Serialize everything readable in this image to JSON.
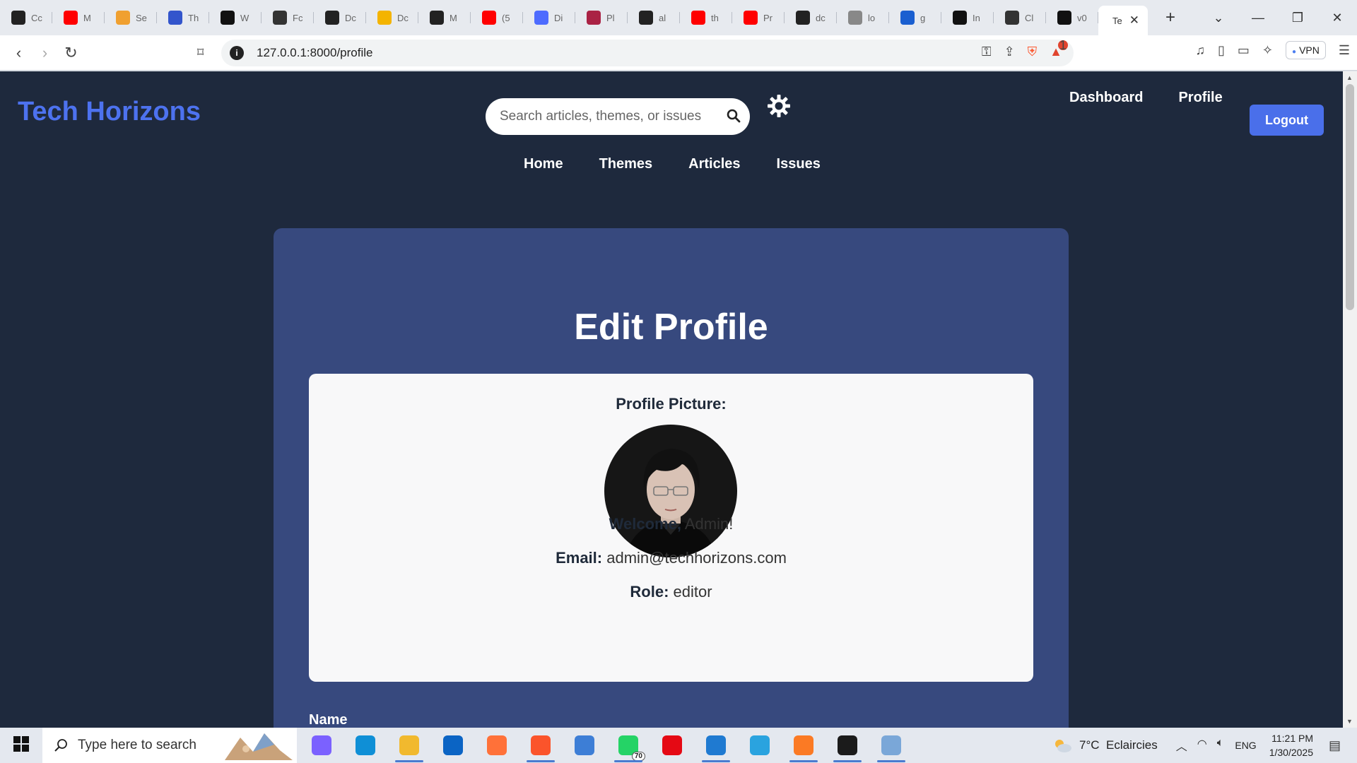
{
  "browser": {
    "tabs": [
      {
        "label": "Cc",
        "icon": "github-icon",
        "color": "#222222"
      },
      {
        "label": "M",
        "icon": "youtube-icon",
        "color": "#ff0000"
      },
      {
        "label": "Se",
        "icon": "bookmark-ribbon-icon",
        "color": "#f0a030"
      },
      {
        "label": "Th",
        "icon": "power-icon",
        "color": "#3355cc"
      },
      {
        "label": "W",
        "icon": "medium-icon",
        "color": "#111111"
      },
      {
        "label": "Fc",
        "icon": "openai-icon",
        "color": "#333333"
      },
      {
        "label": "Dc",
        "icon": "github-icon",
        "color": "#222222"
      },
      {
        "label": "Dc",
        "icon": "google-slides-icon",
        "color": "#f4b400"
      },
      {
        "label": "M",
        "icon": "github-icon",
        "color": "#222222"
      },
      {
        "label": "(5",
        "icon": "youtube-icon",
        "color": "#ff0000"
      },
      {
        "label": "Di",
        "icon": "deepseek-icon",
        "color": "#4d6bfe"
      },
      {
        "label": "Pl",
        "icon": "platform-icon",
        "color": "#aa2244"
      },
      {
        "label": "al",
        "icon": "github-icon",
        "color": "#222222"
      },
      {
        "label": "th",
        "icon": "youtube-icon",
        "color": "#ff0000"
      },
      {
        "label": "Pr",
        "icon": "youtube-icon",
        "color": "#ff0000"
      },
      {
        "label": "dc",
        "icon": "github-icon",
        "color": "#222222"
      },
      {
        "label": "lo",
        "icon": "mountain-icon",
        "color": "#888888"
      },
      {
        "label": "g",
        "icon": "wikipedia-w-icon",
        "color": "#1a5fd0"
      },
      {
        "label": "In",
        "icon": "openai-icon",
        "color": "#111111"
      },
      {
        "label": "Cl",
        "icon": "openai-icon",
        "color": "#333333"
      },
      {
        "label": "v0",
        "icon": "v0-icon",
        "color": "#111111"
      }
    ],
    "active_tab": {
      "label": "Te"
    },
    "url": "127.0.0.1:8000/profile",
    "rewards_count": "1",
    "vpn_label": "VPN"
  },
  "site": {
    "brand": "Tech Horizons",
    "search_placeholder": "Search articles, themes, or issues",
    "top_links": [
      "Dashboard",
      "Profile"
    ],
    "logout_label": "Logout",
    "nav": [
      "Home",
      "Themes",
      "Articles",
      "Issues"
    ],
    "accent_color": "#4a6fea"
  },
  "profile": {
    "title": "Edit Profile",
    "picture_label": "Profile Picture:",
    "welcome_label": "Welcome,",
    "welcome_name": "Admin!",
    "email_label": "Email:",
    "email": "admin@techhorizons.com",
    "role_label": "Role:",
    "role": "editor",
    "name_field_label": "Name"
  },
  "taskbar": {
    "search_placeholder": "Type here to search",
    "apps": [
      {
        "name": "copilot-icon",
        "color": "#7b61ff",
        "open": false
      },
      {
        "name": "edge-icon",
        "color": "#0f8fd6",
        "open": false
      },
      {
        "name": "file-explorer-icon",
        "color": "#f1b92e",
        "open": true
      },
      {
        "name": "outlook-icon",
        "color": "#0b64c4",
        "open": false
      },
      {
        "name": "firefox-icon",
        "color": "#ff7139",
        "open": false
      },
      {
        "name": "brave-icon",
        "color": "#fb542b",
        "open": true
      },
      {
        "name": "qbittorrent-icon",
        "color": "#3d7ed6",
        "open": false
      },
      {
        "name": "whatsapp-icon",
        "color": "#25d366",
        "open": true,
        "badge": "70"
      },
      {
        "name": "netflix-icon",
        "color": "#e50914",
        "open": false
      },
      {
        "name": "vscode-icon",
        "color": "#1f7ad1",
        "open": true
      },
      {
        "name": "telegram-icon",
        "color": "#2aa3df",
        "open": false
      },
      {
        "name": "xampp-icon",
        "color": "#fb7a24",
        "open": true
      },
      {
        "name": "terminal-icon",
        "color": "#1b1b1b",
        "open": true
      },
      {
        "name": "image-viewer-icon",
        "color": "#7aa7d8",
        "open": true
      }
    ],
    "weather_temp": "7°C",
    "weather_text": "Eclaircies",
    "lang": "ENG",
    "time": "11:21 PM",
    "date": "1/30/2025"
  }
}
